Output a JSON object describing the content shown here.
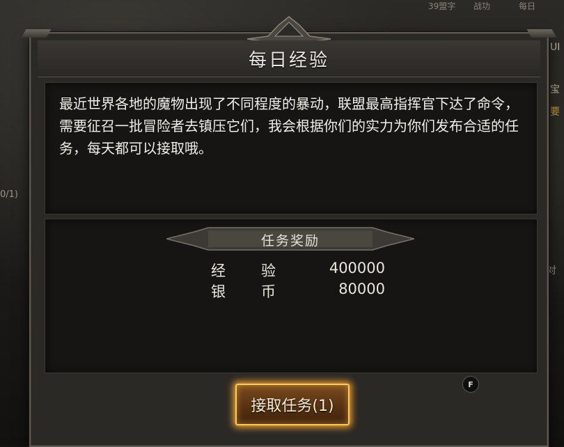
{
  "background": {
    "fragments": [
      "39盟字",
      "战功",
      "每日",
      "0/1)",
      "宝",
      "要",
      "对",
      "UI"
    ]
  },
  "dialog": {
    "title": "每日经验",
    "description": "最近世界各地的魔物出现了不同程度的暴动，联盟最高指挥官下达了命令，需要征召一批冒险者去镇压它们，我会根据你们的实力为你们发布合适的任务，每天都可以接取哦。",
    "reward_section": {
      "title": "任务奖励",
      "rewards": [
        {
          "label_a": "经",
          "label_b": "验",
          "value": "400000"
        },
        {
          "label_a": "银",
          "label_b": "币",
          "value": "80000"
        }
      ]
    },
    "accept_button": "接取任务(1)",
    "hotkey": "F"
  },
  "colors": {
    "accent_glow": "#f2a030",
    "panel_bg": "#161514",
    "frame": "#5e5a53"
  }
}
